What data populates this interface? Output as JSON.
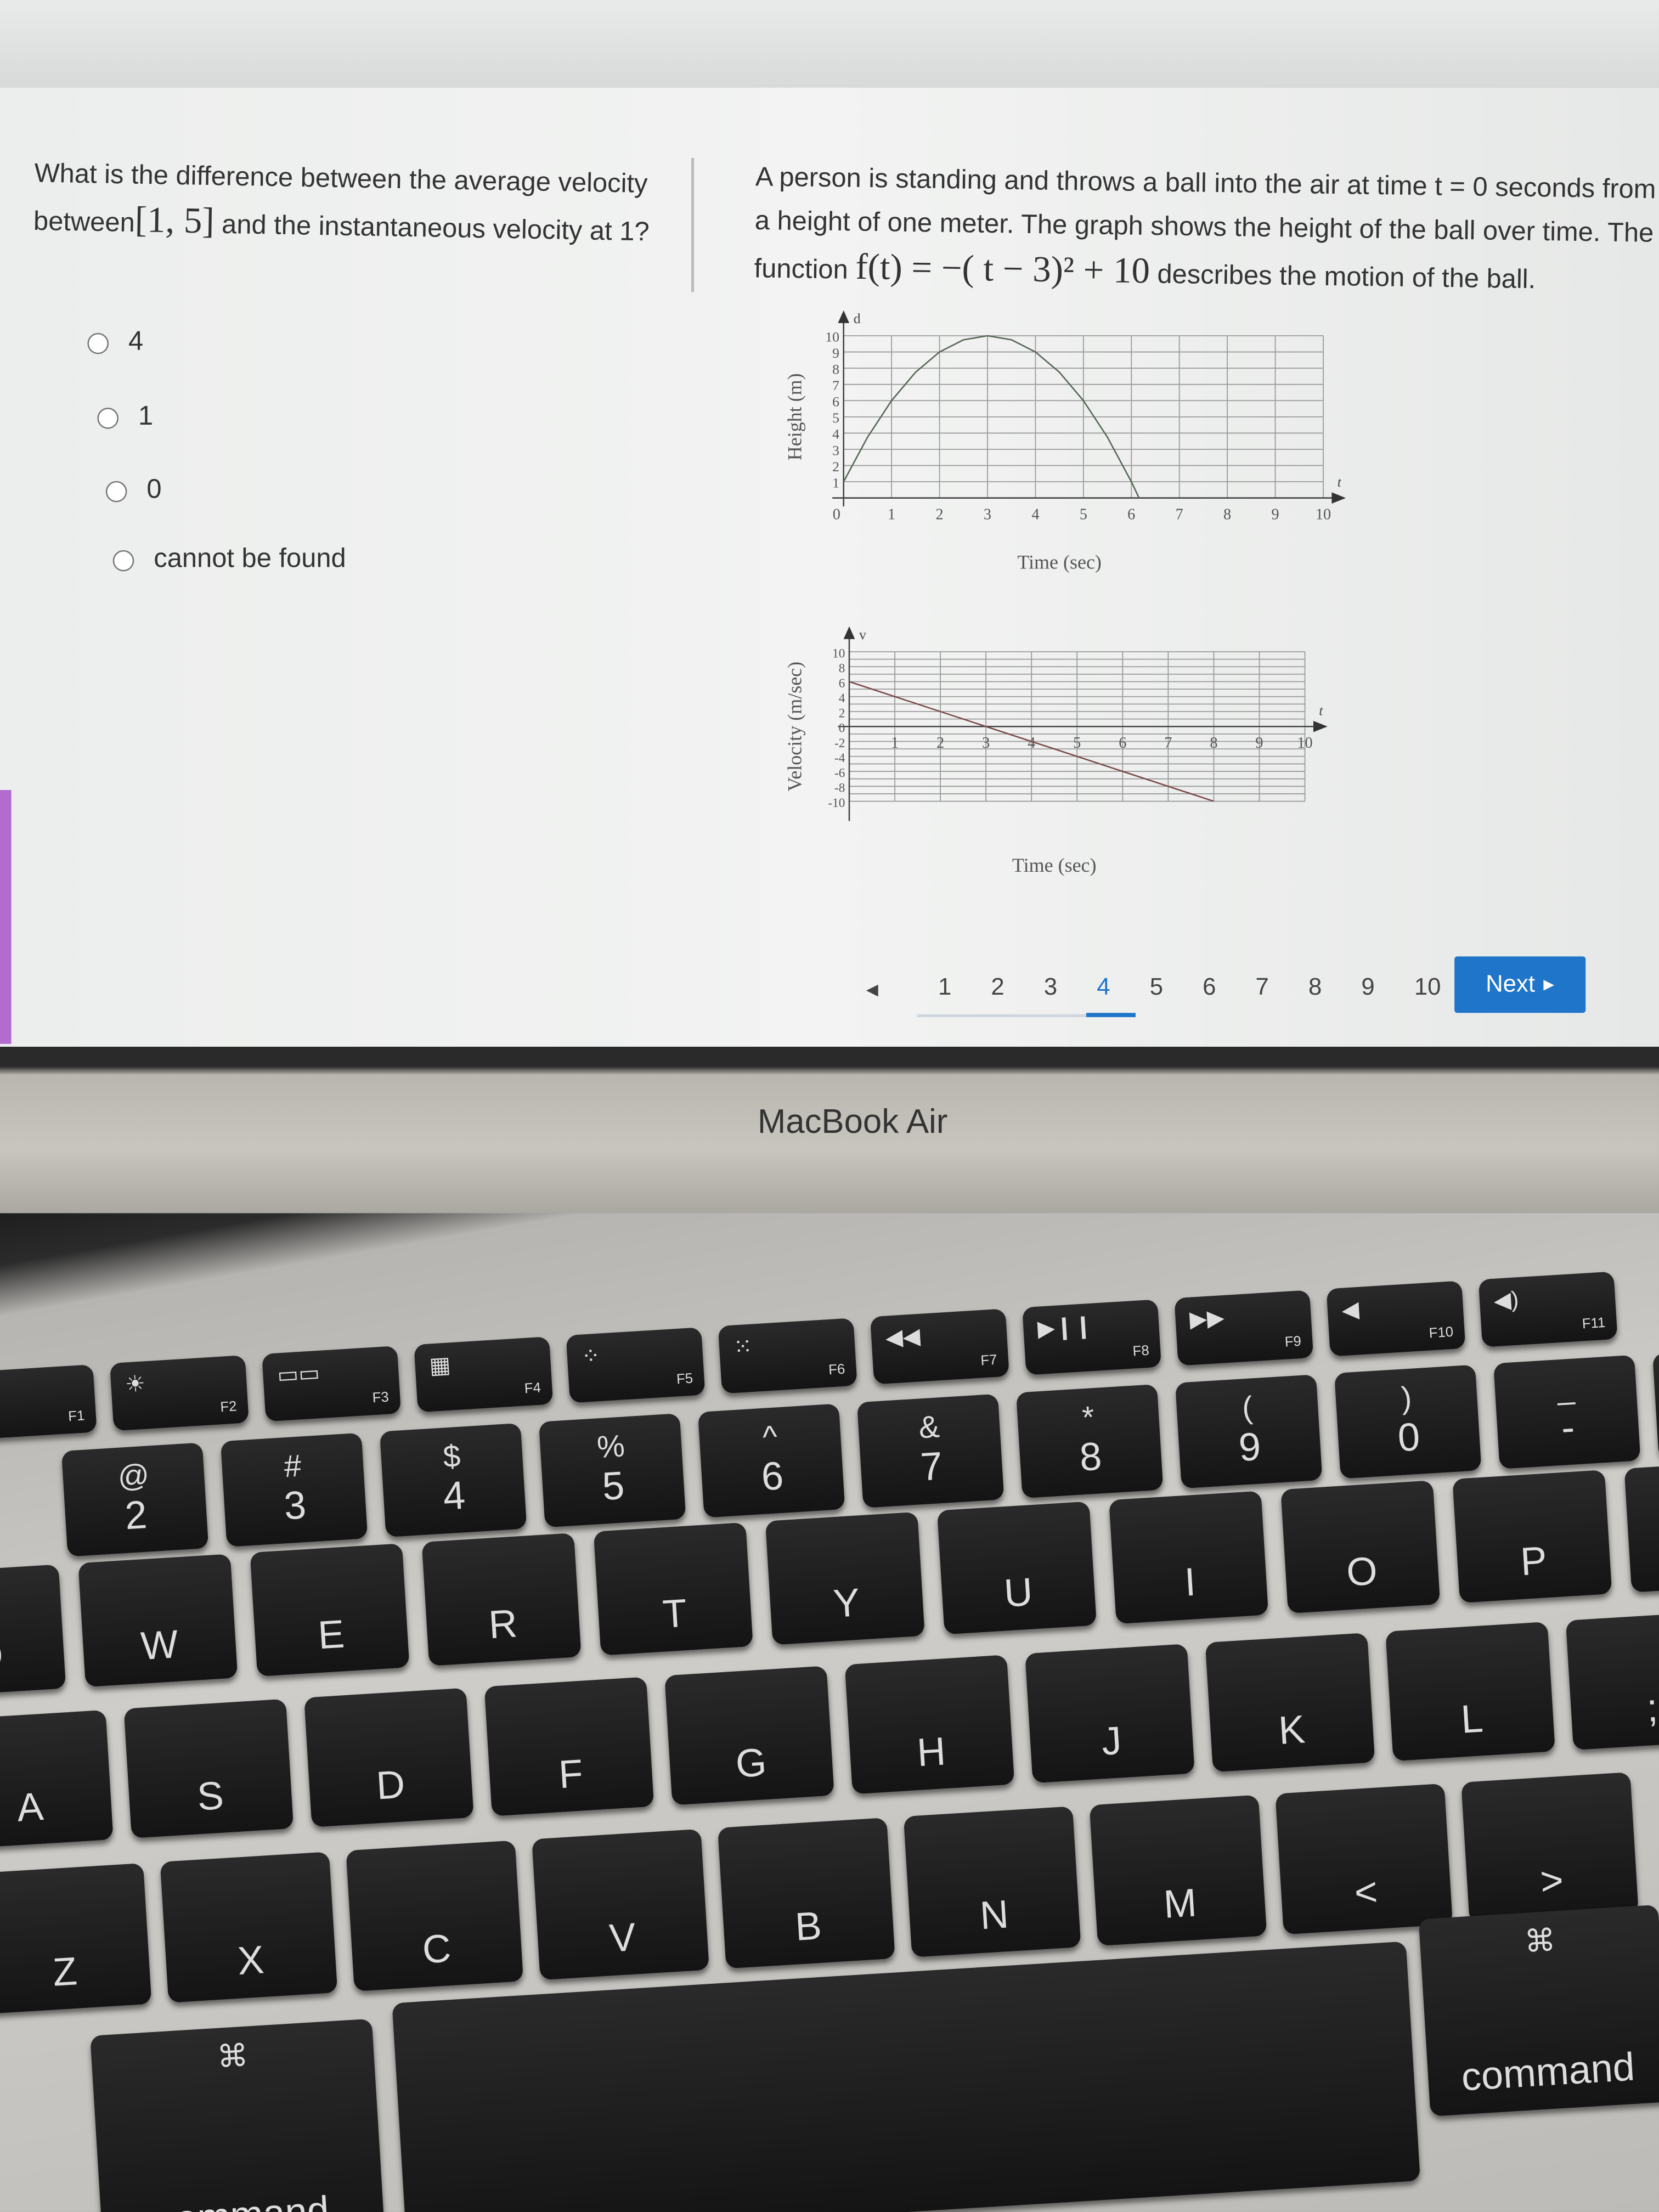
{
  "question": {
    "text_before": "What is the difference between the average velocity between",
    "interval": "[1, 5]",
    "text_after": "and the instantaneous velocity at 1?"
  },
  "context": {
    "text": "A person is standing and throws a ball into the air at time t = 0 seconds from a height of one meter. The graph shows the height of the ball over time. The",
    "function_label": "function",
    "formula": "f(t) = −( t − 3)² + 10",
    "text_end": "describes the motion of the ball."
  },
  "options": [
    {
      "label": "4",
      "selected": false
    },
    {
      "label": "1",
      "selected": false
    },
    {
      "label": "0",
      "selected": false
    },
    {
      "label": "cannot be found",
      "selected": false
    }
  ],
  "pagination": {
    "prev_icon": "triangle-left-icon",
    "pages": [
      "1",
      "2",
      "3",
      "4",
      "5",
      "6",
      "7",
      "8",
      "9",
      "10"
    ],
    "current": "4",
    "next_label": "Next",
    "next_icon": "triangle-right-icon",
    "accent": "#1f75c9"
  },
  "laptop": {
    "brand": "MacBook Air"
  },
  "chart_data": [
    {
      "type": "line",
      "xlabel": "Time (sec)",
      "ylabel": "Height (m)",
      "x_axis_var": "t",
      "y_axis_var": "d",
      "xlim": [
        0,
        10
      ],
      "ylim": [
        0,
        10
      ],
      "x_ticks": [
        "0",
        "1",
        "2",
        "3",
        "4",
        "5",
        "6",
        "7",
        "8",
        "9",
        "10"
      ],
      "y_ticks": [
        "1",
        "2",
        "3",
        "4",
        "5",
        "6",
        "7",
        "8",
        "9",
        "10"
      ],
      "grid": true,
      "series": [
        {
          "x": [
            0,
            0.5,
            1,
            1.5,
            2,
            2.5,
            3,
            3.5,
            4,
            4.5,
            5,
            5.5,
            6,
            6.16
          ],
          "y": [
            1,
            3.75,
            6,
            7.75,
            9,
            9.75,
            10,
            9.75,
            9,
            7.75,
            6,
            3.75,
            1,
            0
          ]
        }
      ]
    },
    {
      "type": "line",
      "xlabel": "Time (sec)",
      "ylabel": "Velocity (m/sec)",
      "x_axis_var": "t",
      "y_axis_var": "v",
      "xlim": [
        0,
        10
      ],
      "ylim": [
        -10,
        10
      ],
      "x_ticks": [
        "1",
        "2",
        "3",
        "4",
        "5",
        "6",
        "7",
        "8",
        "9",
        "10"
      ],
      "y_ticks": [
        "10",
        "8",
        "6",
        "4",
        "2",
        "0",
        "-2",
        "-4",
        "-6",
        "-8",
        "-10"
      ],
      "grid": true,
      "series": [
        {
          "x": [
            0,
            8
          ],
          "y": [
            6,
            -10
          ]
        }
      ]
    }
  ],
  "keyboard": {
    "function_row": [
      {
        "icon": "brightness-down-icon",
        "glyph": "☼",
        "fn": "F1"
      },
      {
        "icon": "brightness-up-icon",
        "glyph": "☀",
        "fn": "F2"
      },
      {
        "icon": "mission-control-icon",
        "glyph": "▭▭",
        "fn": "F3"
      },
      {
        "icon": "launchpad-icon",
        "glyph": "▦",
        "fn": "F4"
      },
      {
        "icon": "keyboard-light-down-icon",
        "glyph": "⁘",
        "fn": "F5"
      },
      {
        "icon": "keyboard-light-up-icon",
        "glyph": "⁙",
        "fn": "F6"
      },
      {
        "icon": "rewind-icon",
        "glyph": "◀◀",
        "fn": "F7"
      },
      {
        "icon": "play-pause-icon",
        "glyph": "▶❙❙",
        "fn": "F8"
      },
      {
        "icon": "fast-forward-icon",
        "glyph": "▶▶",
        "fn": "F9"
      },
      {
        "icon": "mute-icon",
        "glyph": "◀",
        "fn": "F10"
      },
      {
        "icon": "volume-down-icon",
        "glyph": "◀)",
        "fn": "F11"
      }
    ],
    "number_row": [
      [
        "@",
        "2"
      ],
      [
        "#",
        "3"
      ],
      [
        "$",
        "4"
      ],
      [
        "%",
        "5"
      ],
      [
        "^",
        "6"
      ],
      [
        "&",
        "7"
      ],
      [
        "*",
        "8"
      ],
      [
        "(",
        "9"
      ],
      [
        ")",
        "0"
      ],
      [
        "_",
        "-"
      ],
      [
        "+",
        "="
      ]
    ],
    "qwerty_row": [
      "Q",
      "W",
      "E",
      "R",
      "T",
      "Y",
      "U",
      "I",
      "O",
      "P",
      "{"
    ],
    "home_row": [
      "A",
      "S",
      "D",
      "F",
      "G",
      "H",
      "J",
      "K",
      "L",
      ";"
    ],
    "bottom_letters": [
      "Z",
      "X",
      "C",
      "V",
      "B",
      "N",
      "M",
      "<",
      ">"
    ],
    "command_symbol": "⌘",
    "command_label": "command"
  }
}
